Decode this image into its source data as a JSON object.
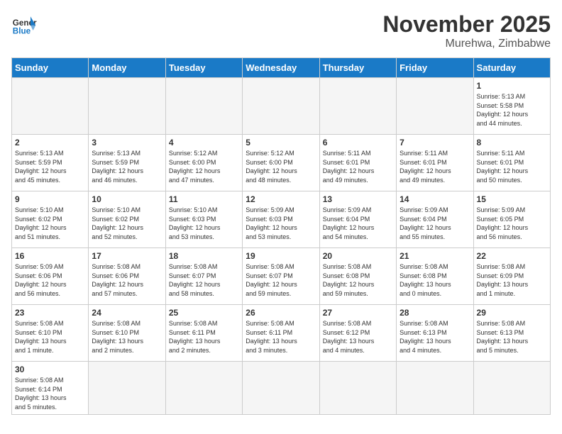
{
  "header": {
    "logo_general": "General",
    "logo_blue": "Blue",
    "month_title": "November 2025",
    "location": "Murehwa, Zimbabwe"
  },
  "days_of_week": [
    "Sunday",
    "Monday",
    "Tuesday",
    "Wednesday",
    "Thursday",
    "Friday",
    "Saturday"
  ],
  "weeks": [
    [
      {
        "day": "",
        "info": "",
        "empty": true
      },
      {
        "day": "",
        "info": "",
        "empty": true
      },
      {
        "day": "",
        "info": "",
        "empty": true
      },
      {
        "day": "",
        "info": "",
        "empty": true
      },
      {
        "day": "",
        "info": "",
        "empty": true
      },
      {
        "day": "",
        "info": "",
        "empty": true
      },
      {
        "day": "1",
        "info": "Sunrise: 5:13 AM\nSunset: 5:58 PM\nDaylight: 12 hours\nand 44 minutes."
      }
    ],
    [
      {
        "day": "2",
        "info": "Sunrise: 5:13 AM\nSunset: 5:59 PM\nDaylight: 12 hours\nand 45 minutes."
      },
      {
        "day": "3",
        "info": "Sunrise: 5:13 AM\nSunset: 5:59 PM\nDaylight: 12 hours\nand 46 minutes."
      },
      {
        "day": "4",
        "info": "Sunrise: 5:12 AM\nSunset: 6:00 PM\nDaylight: 12 hours\nand 47 minutes."
      },
      {
        "day": "5",
        "info": "Sunrise: 5:12 AM\nSunset: 6:00 PM\nDaylight: 12 hours\nand 48 minutes."
      },
      {
        "day": "6",
        "info": "Sunrise: 5:11 AM\nSunset: 6:01 PM\nDaylight: 12 hours\nand 49 minutes."
      },
      {
        "day": "7",
        "info": "Sunrise: 5:11 AM\nSunset: 6:01 PM\nDaylight: 12 hours\nand 49 minutes."
      },
      {
        "day": "8",
        "info": "Sunrise: 5:11 AM\nSunset: 6:01 PM\nDaylight: 12 hours\nand 50 minutes."
      }
    ],
    [
      {
        "day": "9",
        "info": "Sunrise: 5:10 AM\nSunset: 6:02 PM\nDaylight: 12 hours\nand 51 minutes."
      },
      {
        "day": "10",
        "info": "Sunrise: 5:10 AM\nSunset: 6:02 PM\nDaylight: 12 hours\nand 52 minutes."
      },
      {
        "day": "11",
        "info": "Sunrise: 5:10 AM\nSunset: 6:03 PM\nDaylight: 12 hours\nand 53 minutes."
      },
      {
        "day": "12",
        "info": "Sunrise: 5:09 AM\nSunset: 6:03 PM\nDaylight: 12 hours\nand 53 minutes."
      },
      {
        "day": "13",
        "info": "Sunrise: 5:09 AM\nSunset: 6:04 PM\nDaylight: 12 hours\nand 54 minutes."
      },
      {
        "day": "14",
        "info": "Sunrise: 5:09 AM\nSunset: 6:04 PM\nDaylight: 12 hours\nand 55 minutes."
      },
      {
        "day": "15",
        "info": "Sunrise: 5:09 AM\nSunset: 6:05 PM\nDaylight: 12 hours\nand 56 minutes."
      }
    ],
    [
      {
        "day": "16",
        "info": "Sunrise: 5:09 AM\nSunset: 6:06 PM\nDaylight: 12 hours\nand 56 minutes."
      },
      {
        "day": "17",
        "info": "Sunrise: 5:08 AM\nSunset: 6:06 PM\nDaylight: 12 hours\nand 57 minutes."
      },
      {
        "day": "18",
        "info": "Sunrise: 5:08 AM\nSunset: 6:07 PM\nDaylight: 12 hours\nand 58 minutes."
      },
      {
        "day": "19",
        "info": "Sunrise: 5:08 AM\nSunset: 6:07 PM\nDaylight: 12 hours\nand 59 minutes."
      },
      {
        "day": "20",
        "info": "Sunrise: 5:08 AM\nSunset: 6:08 PM\nDaylight: 12 hours\nand 59 minutes."
      },
      {
        "day": "21",
        "info": "Sunrise: 5:08 AM\nSunset: 6:08 PM\nDaylight: 13 hours\nand 0 minutes."
      },
      {
        "day": "22",
        "info": "Sunrise: 5:08 AM\nSunset: 6:09 PM\nDaylight: 13 hours\nand 1 minute."
      }
    ],
    [
      {
        "day": "23",
        "info": "Sunrise: 5:08 AM\nSunset: 6:10 PM\nDaylight: 13 hours\nand 1 minute."
      },
      {
        "day": "24",
        "info": "Sunrise: 5:08 AM\nSunset: 6:10 PM\nDaylight: 13 hours\nand 2 minutes."
      },
      {
        "day": "25",
        "info": "Sunrise: 5:08 AM\nSunset: 6:11 PM\nDaylight: 13 hours\nand 2 minutes."
      },
      {
        "day": "26",
        "info": "Sunrise: 5:08 AM\nSunset: 6:11 PM\nDaylight: 13 hours\nand 3 minutes."
      },
      {
        "day": "27",
        "info": "Sunrise: 5:08 AM\nSunset: 6:12 PM\nDaylight: 13 hours\nand 4 minutes."
      },
      {
        "day": "28",
        "info": "Sunrise: 5:08 AM\nSunset: 6:13 PM\nDaylight: 13 hours\nand 4 minutes."
      },
      {
        "day": "29",
        "info": "Sunrise: 5:08 AM\nSunset: 6:13 PM\nDaylight: 13 hours\nand 5 minutes."
      }
    ],
    [
      {
        "day": "30",
        "info": "Sunrise: 5:08 AM\nSunset: 6:14 PM\nDaylight: 13 hours\nand 5 minutes."
      },
      {
        "day": "",
        "info": "",
        "empty": true
      },
      {
        "day": "",
        "info": "",
        "empty": true
      },
      {
        "day": "",
        "info": "",
        "empty": true
      },
      {
        "day": "",
        "info": "",
        "empty": true
      },
      {
        "day": "",
        "info": "",
        "empty": true
      },
      {
        "day": "",
        "info": "",
        "empty": true
      }
    ]
  ]
}
